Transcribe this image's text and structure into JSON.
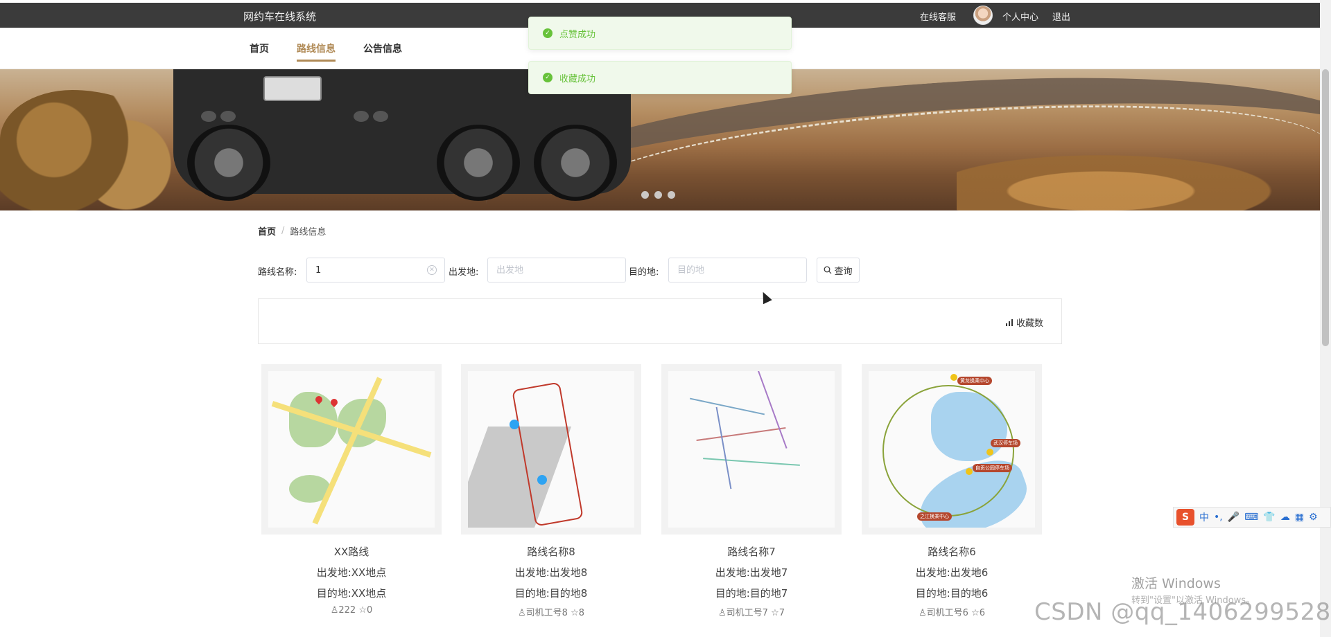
{
  "header": {
    "site_title": "网约车在线系统",
    "links": {
      "service": "在线客服",
      "profile": "个人中心",
      "logout": "退出"
    }
  },
  "nav": {
    "items": [
      {
        "label": "首页"
      },
      {
        "label": "路线信息",
        "active": true
      },
      {
        "label": "公告信息"
      }
    ]
  },
  "toasts": [
    {
      "message": "点赞成功"
    },
    {
      "message": "收藏成功"
    }
  ],
  "breadcrumb": {
    "home": "首页",
    "separator": "/",
    "current": "路线信息"
  },
  "search": {
    "route_name_label": "路线名称:",
    "route_name_value": "1",
    "origin_label": "出发地:",
    "origin_placeholder": "出发地",
    "destination_label": "目的地:",
    "destination_placeholder": "目的地",
    "query_label": "查询"
  },
  "sort": {
    "label": "收藏数"
  },
  "cards": [
    {
      "title": "XX路线",
      "origin": "出发地:XX地点",
      "destination": "目的地:XX地点",
      "driver": "222",
      "favorites": "0"
    },
    {
      "title": "路线名称8",
      "origin": "出发地:出发地8",
      "destination": "目的地:目的地8",
      "driver": "司机工号8",
      "favorites": "8"
    },
    {
      "title": "路线名称7",
      "origin": "出发地:出发地7",
      "destination": "目的地:目的地7",
      "driver": "司机工号7",
      "favorites": "7"
    },
    {
      "title": "路线名称6",
      "origin": "出发地:出发地6",
      "destination": "目的地:目的地6",
      "driver": "司机工号6",
      "favorites": "6"
    }
  ],
  "map_labels": {
    "m4_tag1": "黄龙换乘中心",
    "m4_tag2": "武汉停车场",
    "m4_tag3": "自贡公园停车场",
    "m4_tag4": "之江换乘中心"
  },
  "overlay": {
    "ime_items": [
      "中",
      "•,",
      "🎤",
      "⌨",
      "👕",
      "☁",
      "▦",
      "⚙"
    ],
    "activate_title": "激活 Windows",
    "activate_sub": "转到\"设置\"以激活 Windows。",
    "csdn": "CSDN @qq_1406299528"
  },
  "colors": {
    "accent": "#b08a56",
    "topbar": "#3b3b3b",
    "success": "#67c23a"
  }
}
